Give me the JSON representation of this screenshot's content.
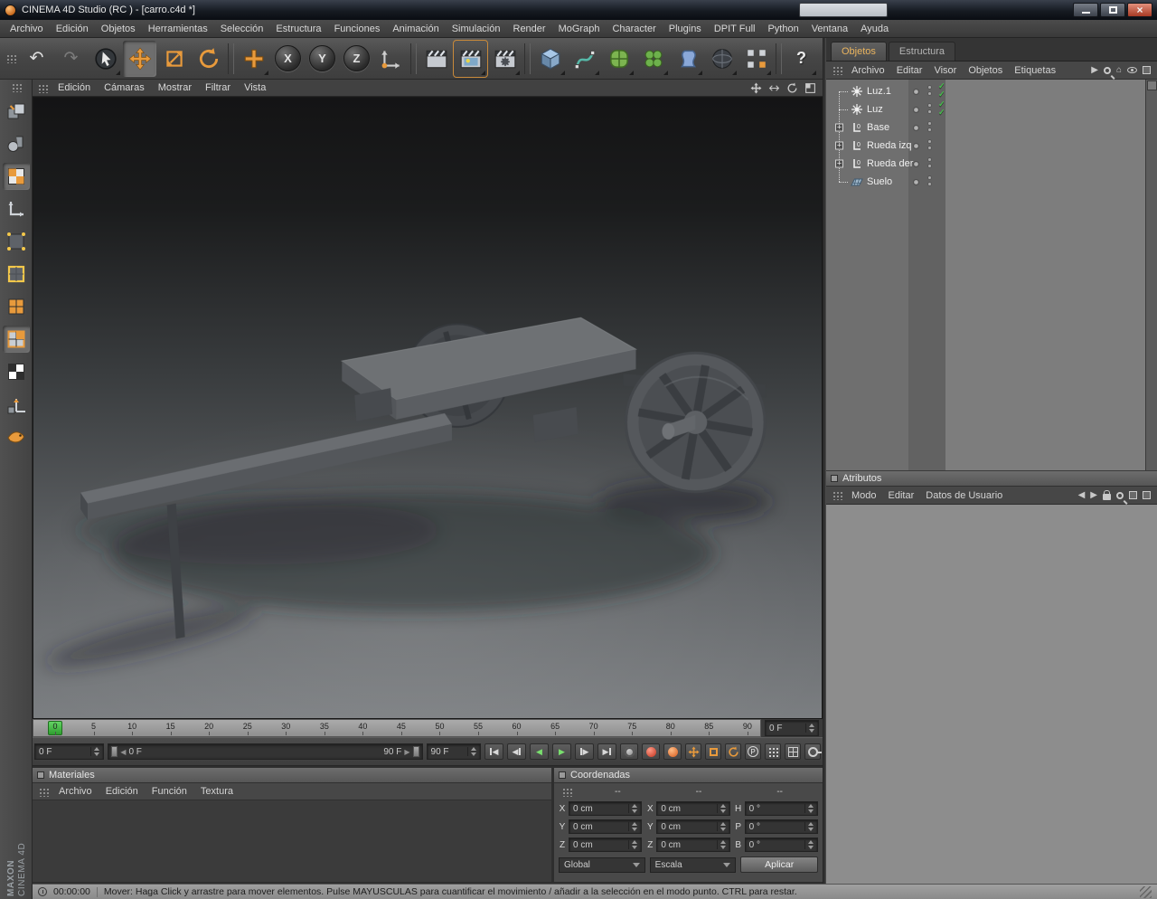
{
  "window": {
    "title": "CINEMA 4D Studio (RC ) - [carro.c4d *]"
  },
  "menubar": {
    "items": [
      "Archivo",
      "Edición",
      "Objetos",
      "Herramientas",
      "Selección",
      "Estructura",
      "Funciones",
      "Animación",
      "Simulación",
      "Render",
      "MoGraph",
      "Character",
      "Plugins",
      "DPIT Full",
      "Python",
      "Ventana",
      "Ayuda"
    ]
  },
  "toolbar": {
    "axis": {
      "x": "X",
      "y": "Y",
      "z": "Z"
    }
  },
  "viewport": {
    "menu": [
      "Edición",
      "Cámaras",
      "Mostrar",
      "Filtrar",
      "Vista"
    ]
  },
  "timeline": {
    "ticks": [
      "0",
      "5",
      "10",
      "15",
      "20",
      "25",
      "30",
      "35",
      "40",
      "45",
      "50",
      "55",
      "60",
      "65",
      "70",
      "75",
      "80",
      "85",
      "90"
    ],
    "frame_field": "0 F"
  },
  "transport": {
    "current_field": "0 F",
    "range_start": "0 F",
    "range_end": "90 F",
    "end_field": "90 F"
  },
  "object_manager": {
    "tabs": [
      "Objetos",
      "Estructura"
    ],
    "menu": [
      "Archivo",
      "Editar",
      "Visor",
      "Objetos",
      "Etiquetas"
    ],
    "objects": [
      {
        "name": "Luz.1"
      },
      {
        "name": "Luz"
      },
      {
        "name": "Base"
      },
      {
        "name": "Rueda izq"
      },
      {
        "name": "Rueda der"
      },
      {
        "name": "Suelo"
      }
    ]
  },
  "attributes": {
    "title": "Atributos",
    "menu": [
      "Modo",
      "Editar",
      "Datos de Usuario"
    ]
  },
  "materials": {
    "title": "Materiales",
    "menu": [
      "Archivo",
      "Edición",
      "Función",
      "Textura"
    ]
  },
  "coordinates": {
    "title": "Coordenadas",
    "headers": [
      "--",
      "--",
      "--"
    ],
    "rows": [
      {
        "l1": "X",
        "v1": "0 cm",
        "l2": "X",
        "v2": "0 cm",
        "l3": "H",
        "v3": "0 °"
      },
      {
        "l1": "Y",
        "v1": "0 cm",
        "l2": "Y",
        "v2": "0 cm",
        "l3": "P",
        "v3": "0 °"
      },
      {
        "l1": "Z",
        "v1": "0 cm",
        "l2": "Z",
        "v2": "0 cm",
        "l3": "B",
        "v3": "0 °"
      }
    ],
    "combo1": "Global",
    "combo2": "Escala",
    "apply": "Aplicar"
  },
  "statusbar": {
    "time": "00:00:00",
    "message": "Mover: Haga Click y arrastre para mover elementos. Pulse MAYUSCULAS para cuantificar el movimiento / añadir a la selección en el modo punto. CTRL para restar."
  },
  "branding": {
    "line1": "MAXON",
    "line2": "CINEMA 4D"
  },
  "icons": {
    "undo": "↶",
    "redo": "↷",
    "help": "?",
    "prev": "◀",
    "next": "▶",
    "play": "▶",
    "reverse": "◀",
    "param": "P",
    "check": "✓",
    "close": "×",
    "expander": "+",
    "null_badge": "0",
    "home": "⌂"
  }
}
